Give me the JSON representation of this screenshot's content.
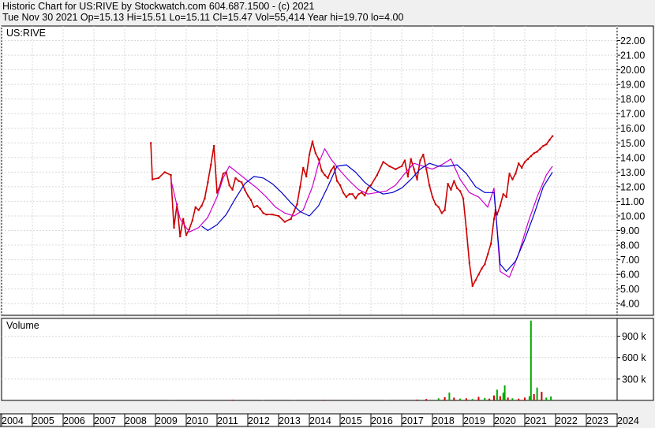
{
  "header": {
    "line1": "Historic Chart for US:RIVE by Stockwatch.com 604.687.1500 - (c) 2021",
    "line2": "Tue Nov 30 2021   Op=15.13   Hi=15.51   Lo=15.11   Cl=15.47   Vol=55,414   Year hi=19.70   lo=4.00"
  },
  "chart_data": [
    {
      "type": "line",
      "title": "US:RIVE",
      "xlabel": "",
      "ylabel": "",
      "ylim": [
        3.2,
        23.0
      ],
      "y_ticks": [
        "4.00",
        "5.00",
        "6.00",
        "7.00",
        "8.00",
        "9.00",
        "10.00",
        "11.00",
        "12.00",
        "13.00",
        "14.00",
        "15.00",
        "16.00",
        "17.00",
        "18.00",
        "19.00",
        "20.00",
        "21.00",
        "22.00"
      ],
      "x_ticks": [
        "2004",
        "2005",
        "2006",
        "2007",
        "2008",
        "2009",
        "2010",
        "2011",
        "2012",
        "2013",
        "2014",
        "2015",
        "2016",
        "2017",
        "2018",
        "2019",
        "2020",
        "2021",
        "2022",
        "2023",
        "2024"
      ],
      "grid": true,
      "series": [
        {
          "kind": "close",
          "color": "#cc0000",
          "x": [
            2008.85,
            2008.9,
            2009.1,
            2009.3,
            2009.5,
            2009.6,
            2009.7,
            2009.8,
            2009.9,
            2010.0,
            2010.1,
            2010.2,
            2010.3,
            2010.4,
            2010.5,
            2010.6,
            2010.7,
            2010.8,
            2010.9,
            2011.0,
            2011.1,
            2011.2,
            2011.3,
            2011.4,
            2011.5,
            2011.6,
            2011.7,
            2011.8,
            2011.9,
            2012.0,
            2012.1,
            2012.2,
            2012.3,
            2012.4,
            2012.5,
            2012.6,
            2012.8,
            2013.0,
            2013.2,
            2013.4,
            2013.5,
            2013.6,
            2013.7,
            2013.8,
            2013.9,
            2014.0,
            2014.1,
            2014.2,
            2014.3,
            2014.4,
            2014.5,
            2014.6,
            2014.7,
            2014.8,
            2014.9,
            2015.0,
            2015.1,
            2015.2,
            2015.3,
            2015.4,
            2015.5,
            2015.6,
            2015.7,
            2015.8,
            2015.9,
            2016.0,
            2016.2,
            2016.4,
            2016.6,
            2016.8,
            2017.0,
            2017.1,
            2017.2,
            2017.3,
            2017.4,
            2017.5,
            2017.6,
            2017.7,
            2017.8,
            2017.9,
            2018.0,
            2018.1,
            2018.2,
            2018.3,
            2018.4,
            2018.5,
            2018.6,
            2018.7,
            2018.8,
            2018.9,
            2019.0,
            2019.1,
            2019.2,
            2019.3,
            2019.4,
            2019.5,
            2019.6,
            2019.7,
            2019.8,
            2019.9,
            2020.0,
            2020.05,
            2020.1,
            2020.2,
            2020.3,
            2020.4,
            2020.5,
            2020.6,
            2020.7,
            2020.8,
            2020.9,
            2021.0,
            2021.1,
            2021.2,
            2021.3,
            2021.4,
            2021.5,
            2021.6,
            2021.7,
            2021.8,
            2021.9
          ],
          "values": [
            15.0,
            12.5,
            12.6,
            13.0,
            12.8,
            9.2,
            10.8,
            8.6,
            9.8,
            8.7,
            9.1,
            9.7,
            10.6,
            10.4,
            10.7,
            11.2,
            12.3,
            13.5,
            14.8,
            11.6,
            12.1,
            12.9,
            13.0,
            12.1,
            11.8,
            12.6,
            12.4,
            12.3,
            11.8,
            11.4,
            11.1,
            10.6,
            10.7,
            10.5,
            10.2,
            10.1,
            10.1,
            10.0,
            9.6,
            9.8,
            10.3,
            10.8,
            12.0,
            13.3,
            12.7,
            14.2,
            15.1,
            14.3,
            13.9,
            13.1,
            12.8,
            12.6,
            13.1,
            13.4,
            12.4,
            12.1,
            11.6,
            11.3,
            11.5,
            11.5,
            11.2,
            11.5,
            11.6,
            11.4,
            11.9,
            12.1,
            12.8,
            13.7,
            13.4,
            13.2,
            13.4,
            13.8,
            12.7,
            13.9,
            13.2,
            12.5,
            13.8,
            14.2,
            13.2,
            12.1,
            11.3,
            10.8,
            10.6,
            10.2,
            10.4,
            12.2,
            11.8,
            12.4,
            11.9,
            11.7,
            11.2,
            9.1,
            6.8,
            5.2,
            5.6,
            6.0,
            6.4,
            6.7,
            7.4,
            8.1,
            9.8,
            10.4,
            10.1,
            10.7,
            11.5,
            11.3,
            12.9,
            12.5,
            12.9,
            13.6,
            13.3,
            13.7,
            13.9,
            14.1,
            14.3,
            14.4,
            14.6,
            14.8,
            14.9,
            15.2,
            15.47
          ]
        },
        {
          "kind": "short-average",
          "color": "#cc00cc",
          "x": [
            2009.5,
            2009.8,
            2010.1,
            2010.4,
            2010.7,
            2011.0,
            2011.2,
            2011.4,
            2011.7,
            2012.0,
            2012.3,
            2012.6,
            2012.9,
            2013.2,
            2013.5,
            2013.8,
            2014.1,
            2014.3,
            2014.5,
            2014.7,
            2015.0,
            2015.3,
            2015.6,
            2015.9,
            2016.2,
            2016.5,
            2016.8,
            2017.1,
            2017.4,
            2017.7,
            2018.0,
            2018.3,
            2018.6,
            2018.9,
            2019.2,
            2019.5,
            2019.8,
            2020.0,
            2020.2,
            2020.5,
            2020.8,
            2021.1,
            2021.4,
            2021.7,
            2021.9
          ],
          "values": [
            12.5,
            9.8,
            8.9,
            9.2,
            9.9,
            11.3,
            12.6,
            13.4,
            12.9,
            12.4,
            11.9,
            11.3,
            10.6,
            10.2,
            10.0,
            10.4,
            12.0,
            13.6,
            14.6,
            13.9,
            13.1,
            12.4,
            11.8,
            11.5,
            11.6,
            11.7,
            12.1,
            12.9,
            13.6,
            13.4,
            13.2,
            13.5,
            13.9,
            12.5,
            11.6,
            11.3,
            10.6,
            11.9,
            6.2,
            5.8,
            7.4,
            9.5,
            11.3,
            12.8,
            13.4
          ]
        },
        {
          "kind": "long-average",
          "color": "#0000cc",
          "x": [
            2010.5,
            2010.7,
            2011.0,
            2011.3,
            2011.6,
            2011.9,
            2012.2,
            2012.5,
            2012.8,
            2013.1,
            2013.4,
            2013.7,
            2014.0,
            2014.3,
            2014.6,
            2014.9,
            2015.2,
            2015.5,
            2015.8,
            2016.1,
            2016.4,
            2016.7,
            2017.0,
            2017.3,
            2017.6,
            2017.9,
            2018.2,
            2018.5,
            2018.8,
            2019.1,
            2019.4,
            2019.7,
            2020.0,
            2020.2,
            2020.4,
            2020.7,
            2021.0,
            2021.3,
            2021.6,
            2021.9
          ],
          "values": [
            9.3,
            9.0,
            9.4,
            10.1,
            11.2,
            12.2,
            12.7,
            12.6,
            12.2,
            11.6,
            10.9,
            10.3,
            10.0,
            10.7,
            12.0,
            13.4,
            13.5,
            13.0,
            12.3,
            11.8,
            11.5,
            11.6,
            11.9,
            12.5,
            13.2,
            13.6,
            13.4,
            13.4,
            13.5,
            12.9,
            12.0,
            11.6,
            11.6,
            6.7,
            6.2,
            6.9,
            8.4,
            10.1,
            12.0,
            13.0
          ]
        }
      ]
    },
    {
      "type": "bar",
      "title": "Volume",
      "ylim": [
        0,
        1150000
      ],
      "y_ticks": [
        "300 k",
        "600 k",
        "900 k"
      ],
      "grid": true,
      "series": [
        {
          "name": "",
          "x": [
            2009.5,
            2010.5,
            2011.5,
            2012.5,
            2013.5,
            2014.5,
            2015.5,
            2016.5,
            2017.5,
            2017.8,
            2018.2,
            2018.4,
            2018.55,
            2018.7,
            2018.9,
            2019.1,
            2019.3,
            2019.5,
            2019.7,
            2019.85,
            2020.0,
            2020.1,
            2020.2,
            2020.3,
            2020.35,
            2020.45,
            2020.6,
            2020.8,
            2021.0,
            2021.15,
            2021.2,
            2021.3,
            2021.4,
            2021.55,
            2021.7,
            2021.85
          ],
          "values": [
            5000,
            8000,
            10000,
            6000,
            6000,
            9000,
            7000,
            6000,
            12000,
            20000,
            30000,
            45000,
            110000,
            40000,
            25000,
            30000,
            20000,
            50000,
            35000,
            25000,
            70000,
            150000,
            60000,
            110000,
            210000,
            40000,
            30000,
            25000,
            40000,
            60000,
            1120000,
            90000,
            180000,
            120000,
            40000,
            55414
          ],
          "colors": [
            "#cc0000",
            "#cc0000",
            "#cc0000",
            "#cc0000",
            "#cc0000",
            "#cc0000",
            "#cc0000",
            "#cc0000",
            "#cc0000",
            "#cc0000",
            "#00aa00",
            "#cc0000",
            "#00aa00",
            "#cc0000",
            "#00aa00",
            "#cc0000",
            "#00aa00",
            "#cc0000",
            "#00aa00",
            "#cc0000",
            "#cc0000",
            "#00aa00",
            "#cc0000",
            "#00aa00",
            "#00aa00",
            "#cc0000",
            "#00aa00",
            "#cc0000",
            "#cc0000",
            "#00aa00",
            "#00aa00",
            "#cc0000",
            "#00aa00",
            "#cc0000",
            "#00aa00",
            "#00aa00"
          ]
        }
      ]
    }
  ]
}
